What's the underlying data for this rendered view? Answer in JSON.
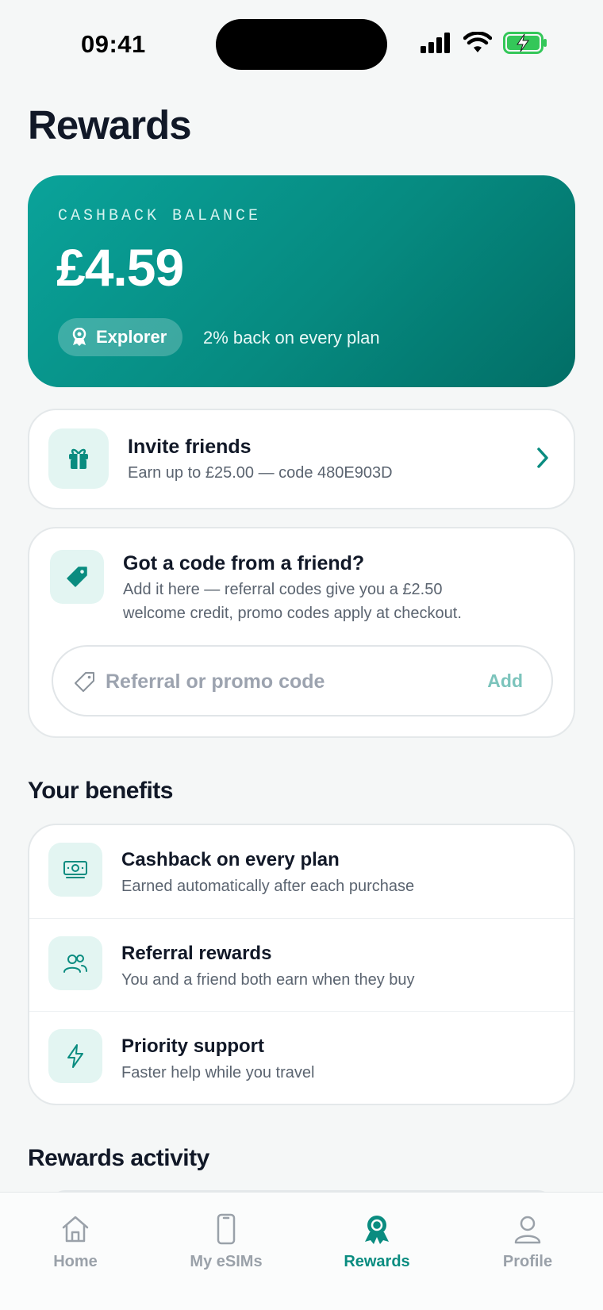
{
  "status_bar": {
    "time": "09:41"
  },
  "page": {
    "title": "Rewards"
  },
  "balance": {
    "label": "CASHBACK BALANCE",
    "amount": "£4.59",
    "tier": "Explorer",
    "tier_description": "2% back on every plan"
  },
  "invite": {
    "title": "Invite friends",
    "subtitle": "Earn up to £25.00 — code 480E903D"
  },
  "code_entry": {
    "title": "Got a code from a friend?",
    "description_line1": "Add it here — referral codes give you a £2.50",
    "description_line2": "welcome credit, promo codes apply at checkout.",
    "input_placeholder": "Referral or promo code",
    "input_value": "",
    "add_label": "Add"
  },
  "benefits": {
    "section_title": "Your benefits",
    "items": [
      {
        "title": "Cashback on every plan",
        "subtitle": "Earned automatically after each purchase",
        "icon": "cash-icon"
      },
      {
        "title": "Referral rewards",
        "subtitle": "You and a friend both earn when they buy",
        "icon": "users-icon"
      },
      {
        "title": "Priority support",
        "subtitle": "Faster help while you travel",
        "icon": "lightning-icon"
      }
    ]
  },
  "activity": {
    "section_title": "Rewards activity"
  },
  "tab_bar": {
    "active": "Rewards",
    "tabs": [
      {
        "label": "Home",
        "icon": "home-icon"
      },
      {
        "label": "My eSIMs",
        "icon": "phone-icon"
      },
      {
        "label": "Rewards",
        "icon": "award-icon"
      },
      {
        "label": "Profile",
        "icon": "user-icon"
      }
    ]
  },
  "colors": {
    "accent": "#0a8c80",
    "card_gradient_start": "#0aa39a",
    "card_gradient_end": "#026e66",
    "icon_tile_bg": "#e3f5f2",
    "battery_green": "#34c759"
  }
}
